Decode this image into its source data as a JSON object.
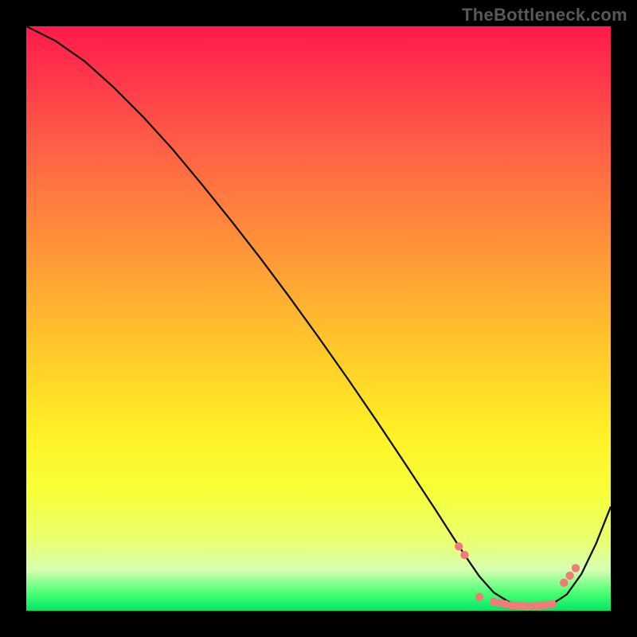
{
  "watermark": "TheBottleneck.com",
  "chart_data": {
    "type": "line",
    "title": "",
    "xlabel": "",
    "ylabel": "",
    "xlim": [
      0,
      100
    ],
    "ylim": [
      0,
      100
    ],
    "series": [
      {
        "name": "bottleneck-curve",
        "x": [
          0,
          5,
          10,
          15,
          20,
          25,
          30,
          35,
          40,
          45,
          50,
          55,
          60,
          65,
          70,
          72.5,
          75,
          77.5,
          80,
          82.5,
          85,
          87.5,
          90,
          92.5,
          95,
          97.5,
          100
        ],
        "values": [
          100,
          97.5,
          94,
          89.5,
          84.5,
          79,
          73,
          66.8,
          60.4,
          53.7,
          46.8,
          39.7,
          32.4,
          24.9,
          17.3,
          13.4,
          9.55,
          5.9,
          3.1,
          1.55,
          0.85,
          0.7,
          1.15,
          2.8,
          6.3,
          11.5,
          17.8
        ]
      }
    ],
    "markers": {
      "name": "optimal-range",
      "color": "#f27a77",
      "points": [
        {
          "x": 74,
          "y": 11.0
        },
        {
          "x": 75,
          "y": 9.55
        },
        {
          "x": 77.5,
          "y": 2.35
        },
        {
          "x": 80,
          "y": 1.55
        },
        {
          "x": 81,
          "y": 1.3
        },
        {
          "x": 82,
          "y": 1.1
        },
        {
          "x": 83,
          "y": 0.95
        },
        {
          "x": 84,
          "y": 0.85
        },
        {
          "x": 85,
          "y": 0.8
        },
        {
          "x": 86,
          "y": 0.78
        },
        {
          "x": 87,
          "y": 0.8
        },
        {
          "x": 88,
          "y": 0.85
        },
        {
          "x": 89,
          "y": 1.0
        },
        {
          "x": 90,
          "y": 1.15
        },
        {
          "x": 92,
          "y": 4.8
        },
        {
          "x": 93,
          "y": 6.0
        },
        {
          "x": 94,
          "y": 7.3
        }
      ]
    },
    "colors": {
      "curve": "#111111",
      "marker": "#f27a77",
      "frame": "#000000"
    }
  }
}
